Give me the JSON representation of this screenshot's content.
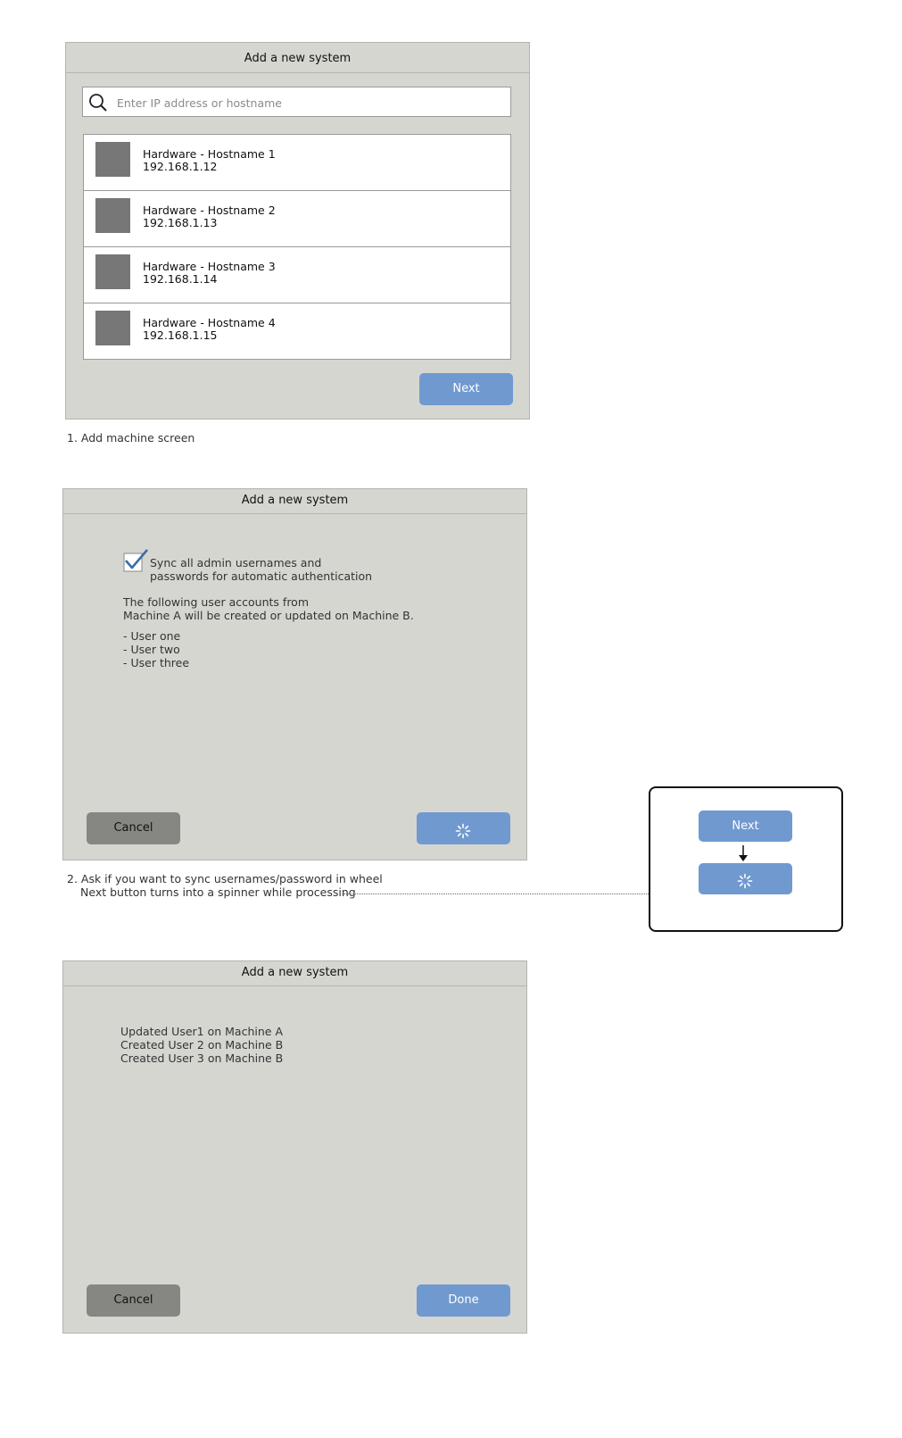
{
  "screen1": {
    "title": "Add a new system",
    "search_placeholder": "Enter IP address or hostname",
    "machines": [
      {
        "name": "Hardware - Hostname 1",
        "ip": "192.168.1.12"
      },
      {
        "name": "Hardware - Hostname 2",
        "ip": "192.168.1.13"
      },
      {
        "name": "Hardware - Hostname 3",
        "ip": "192.168.1.14"
      },
      {
        "name": "Hardware - Hostname 4",
        "ip": "192.168.1.15"
      }
    ],
    "next_label": "Next",
    "caption": "1. Add machine screen"
  },
  "screen2": {
    "title": "Add a new system",
    "sync_checked": true,
    "sync_label_line1": "Sync all admin usernames and",
    "sync_label_line2": "passwords for automatic authentication",
    "info_line1": "The following user accounts from",
    "info_line2": "Machine A will be created or updated on Machine B.",
    "users": [
      "- User one",
      "- User two",
      "- User three"
    ],
    "cancel_label": "Cancel",
    "caption_line1": "2. Ask if you want to sync usernames/password in wheel",
    "caption_line2": "Next button turns into a spinner while processing"
  },
  "annotation": {
    "next_label": "Next"
  },
  "screen3": {
    "title": "Add a new system",
    "results": [
      "Updated User1 on Machine A",
      "Created User 2 on Machine B",
      "Created User 3 on Machine B"
    ],
    "cancel_label": "Cancel",
    "done_label": "Done"
  },
  "colors": {
    "panel_bg": "#d6d6d1",
    "primary_button": "#7099d0",
    "secondary_button": "#868783",
    "thumbnail": "#777777",
    "checkmark": "#3a6ea5"
  },
  "icons": {
    "search": "magnifier-icon",
    "spinner": "spinner-icon",
    "checkbox": "checkbox-checked-icon",
    "arrow": "arrow-down-icon"
  }
}
